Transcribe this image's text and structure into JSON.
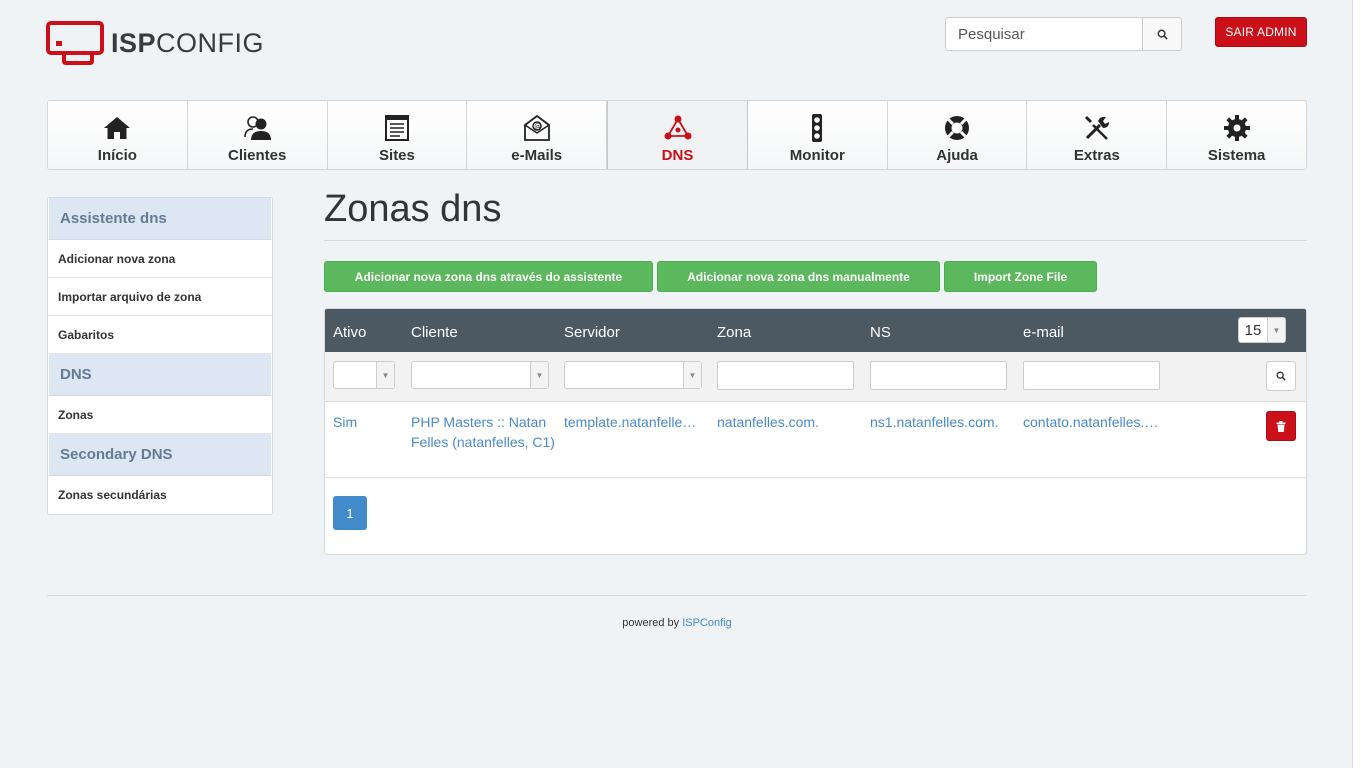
{
  "header": {
    "logo_bold": "ISP",
    "logo_light": "CONFIG",
    "search_placeholder": "Pesquisar",
    "logout_label": "SAIR ADMIN"
  },
  "nav": [
    {
      "label": "Início",
      "icon": "home-icon"
    },
    {
      "label": "Clientes",
      "icon": "users-icon"
    },
    {
      "label": "Sites",
      "icon": "browser-window-icon"
    },
    {
      "label": "e-Mails",
      "icon": "envelope-at-icon"
    },
    {
      "label": "DNS",
      "icon": "network-nodes-icon",
      "active": true
    },
    {
      "label": "Monitor",
      "icon": "traffic-light-icon"
    },
    {
      "label": "Ajuda",
      "icon": "lifebuoy-icon"
    },
    {
      "label": "Extras",
      "icon": "tools-icon"
    },
    {
      "label": "Sistema",
      "icon": "gear-icon"
    }
  ],
  "sidebar": {
    "sections": [
      {
        "title": "Assistente dns",
        "items": [
          "Adicionar nova zona",
          "Importar arquivo de zona",
          "Gabaritos"
        ]
      },
      {
        "title": "DNS",
        "items": [
          "Zonas"
        ]
      },
      {
        "title": "Secondary DNS",
        "items": [
          "Zonas secundárias"
        ]
      }
    ]
  },
  "main": {
    "title": "Zonas dns",
    "buttons": [
      "Adicionar nova zona dns através do assistente",
      "Adicionar nova zona dns manualmente",
      "Import Zone File"
    ],
    "table": {
      "columns": [
        "Ativo",
        "Cliente",
        "Servidor",
        "Zona",
        "NS",
        "e-mail"
      ],
      "per_page": "15",
      "rows": [
        {
          "ativo": "Sim",
          "cliente": "PHP Masters :: Natan Felles (natanfelles, C1)",
          "servidor": "template.natanfelles.com.",
          "zona": "natanfelles.com.",
          "ns": "ns1.natanfelles.com.",
          "email": "contato.natanfelles.com."
        }
      ]
    },
    "pagination": {
      "current": "1"
    }
  },
  "footer": {
    "text": "powered by",
    "link": "ISPConfig"
  },
  "colors": {
    "brand_red": "#cc1019",
    "green": "#5cb85c",
    "link_blue": "#4a8bc7",
    "table_header": "#4c5862"
  }
}
